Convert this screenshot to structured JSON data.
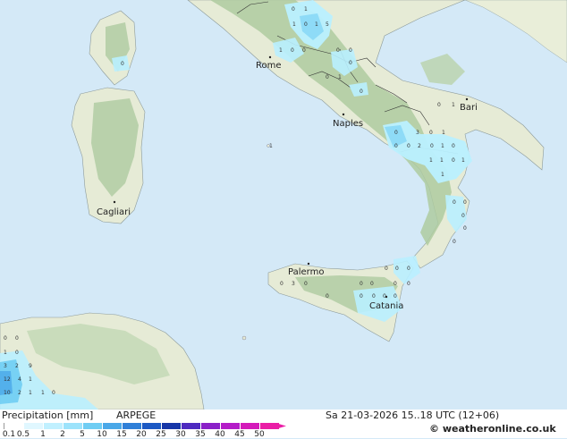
{
  "map": {
    "cities": [
      {
        "name": "Rome"
      },
      {
        "name": "Naples"
      },
      {
        "name": "Bari"
      },
      {
        "name": "Cagliari"
      },
      {
        "name": "Palermo"
      },
      {
        "name": "Catania"
      }
    ],
    "values": [
      "0",
      "1",
      "1",
      "0",
      "1",
      "5",
      "1",
      "0",
      "0",
      "0",
      "0",
      "0",
      "1",
      "0",
      "0",
      "0",
      "1",
      "0",
      "3",
      "0",
      "1",
      "0",
      "0",
      "2",
      "0",
      "1",
      "0",
      "1",
      "1",
      "0",
      "1",
      "1",
      "0",
      "0",
      "0",
      "0",
      "0",
      "1",
      "0",
      "3",
      "0",
      "0",
      "0",
      "0",
      "0",
      "0",
      "0",
      "0",
      "0",
      "0",
      "0",
      "0",
      "0",
      "0",
      "0",
      "0",
      "1",
      "0",
      "3",
      "2",
      "9",
      "12",
      "4",
      "1",
      "10",
      "2",
      "1",
      "1",
      "0"
    ],
    "colors": {
      "sea": "#d4e9f7",
      "land": "#e9eed9",
      "highland": "#a9c99a",
      "precip_light": "#b9f0ff",
      "precip_med": "#8ad8f6"
    }
  },
  "footer": {
    "title": "Precipitation [mm]",
    "model": "ARPEGE",
    "datetime": "Sa 21-03-2026 15..18 UTC (12+06)",
    "copyright": "© weatheronline.co.uk",
    "legend": {
      "ticks": [
        "0.1",
        "0.5",
        "1",
        "2",
        "5",
        "10",
        "15",
        "20",
        "25",
        "30",
        "35",
        "40",
        "45",
        "50"
      ],
      "colors": [
        "#ffffff",
        "#e0f7ff",
        "#c0f0ff",
        "#9ce3fb",
        "#6fcdf3",
        "#4aa8e8",
        "#2f7fd8",
        "#1c59c4",
        "#1636a8",
        "#4e2ac0",
        "#8a20c8",
        "#b41cc8",
        "#d41aba",
        "#ea1ea6"
      ]
    }
  }
}
